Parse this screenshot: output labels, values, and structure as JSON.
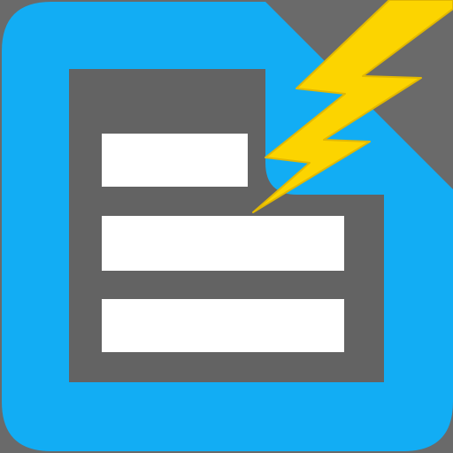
{
  "app_icon": {
    "icon_name": "document-lightning-icon",
    "colors": {
      "backdrop": "#6a6a6a",
      "tile": "#12adf4",
      "document": "#636363",
      "text_lines": "#ffffff",
      "bolt": "#fcd400",
      "bolt_edge": "#e2b800"
    },
    "text_line_count": 3
  }
}
